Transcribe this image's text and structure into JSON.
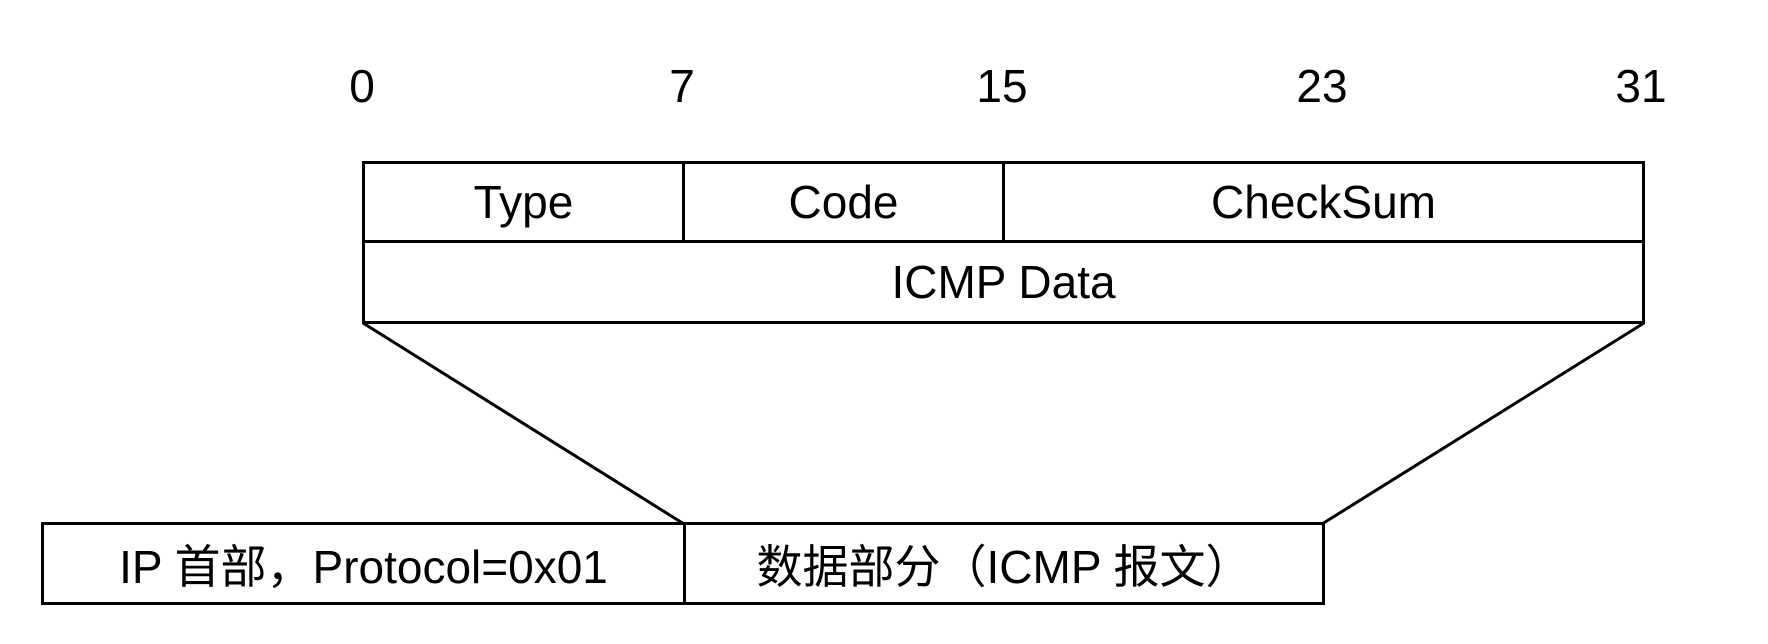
{
  "bit_labels": [
    "0",
    "7",
    "15",
    "23",
    "31"
  ],
  "icmp_header": {
    "type": "Type",
    "code": "Code",
    "checksum": "CheckSum",
    "data": "ICMP Data"
  },
  "ip_packet": {
    "header": "IP 首部，Protocol=0x01",
    "payload": "数据部分（ICMP 报文）"
  }
}
